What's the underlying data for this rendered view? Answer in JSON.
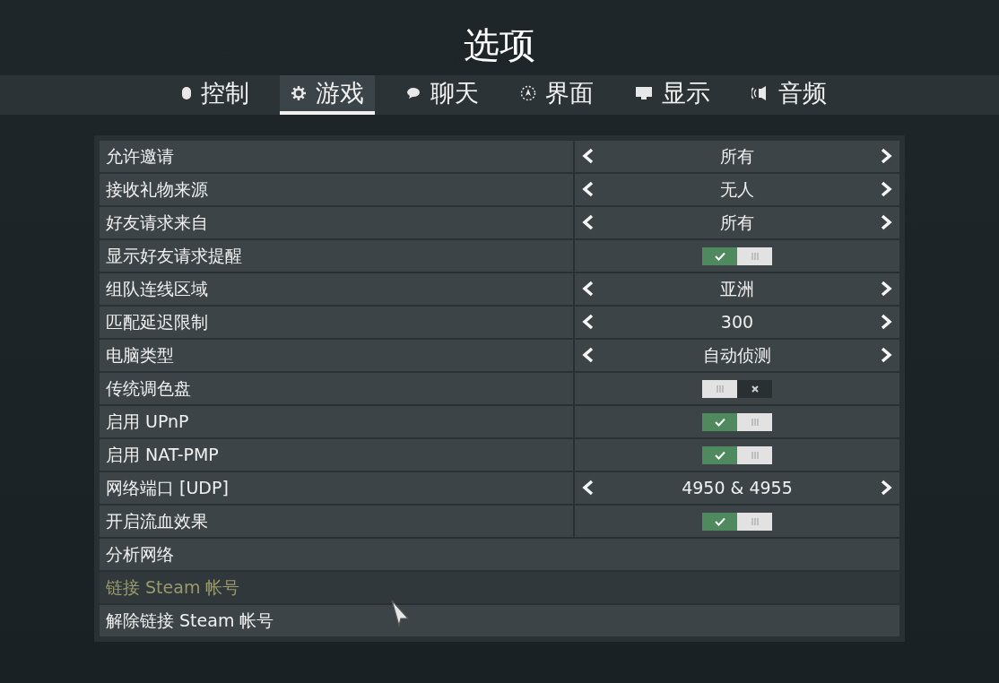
{
  "title": "选项",
  "tabs": [
    {
      "label": "控制",
      "selected": false
    },
    {
      "label": "游戏",
      "selected": true
    },
    {
      "label": "聊天",
      "selected": false
    },
    {
      "label": "界面",
      "selected": false
    },
    {
      "label": "显示",
      "selected": false
    },
    {
      "label": "音频",
      "selected": false
    }
  ],
  "settings": [
    {
      "kind": "selector",
      "label": "允许邀请",
      "value": "所有"
    },
    {
      "kind": "selector",
      "label": "接收礼物来源",
      "value": "无人"
    },
    {
      "kind": "selector",
      "label": "好友请求来自",
      "value": "所有"
    },
    {
      "kind": "toggle",
      "label": "显示好友请求提醒",
      "on": true
    },
    {
      "kind": "selector",
      "label": "组队连线区域",
      "value": "亚洲"
    },
    {
      "kind": "selector",
      "label": "匹配延迟限制",
      "value": "300"
    },
    {
      "kind": "selector",
      "label": "电脑类型",
      "value": "自动侦测"
    },
    {
      "kind": "toggle",
      "label": "传统调色盘",
      "on": false
    },
    {
      "kind": "toggle",
      "label": "启用 UPnP",
      "on": true
    },
    {
      "kind": "toggle",
      "label": "启用 NAT-PMP",
      "on": true
    },
    {
      "kind": "selector",
      "label": "网络端口 [UDP]",
      "value": "4950 & 4955"
    },
    {
      "kind": "toggle",
      "label": "开启流血效果",
      "on": true
    },
    {
      "kind": "action",
      "label": "分析网络",
      "hovered": false
    },
    {
      "kind": "action",
      "label": "链接 Steam 帐号",
      "hovered": true
    },
    {
      "kind": "action",
      "label": "解除链接 Steam 帐号",
      "hovered": false
    }
  ]
}
